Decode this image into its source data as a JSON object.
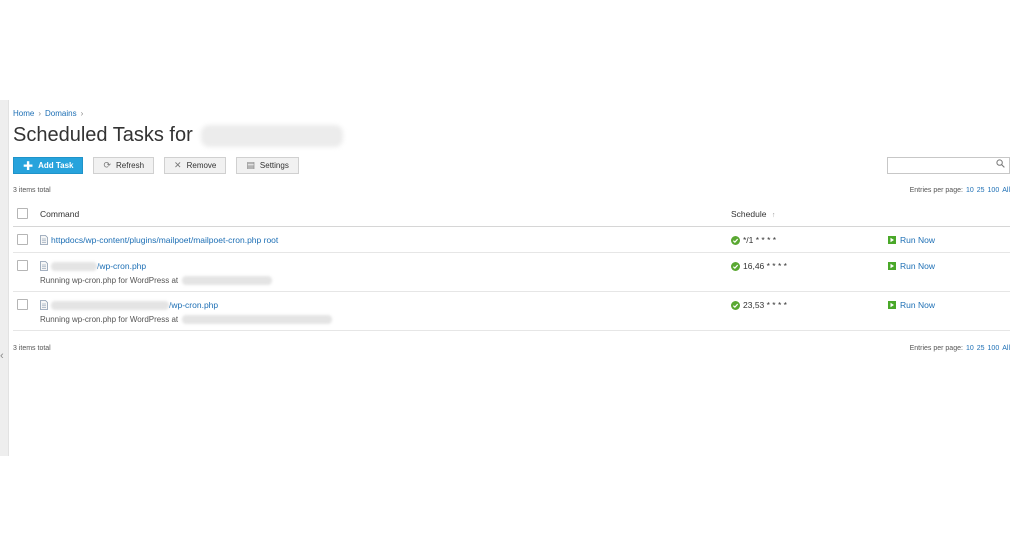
{
  "breadcrumb": {
    "home": "Home",
    "domains": "Domains",
    "separator": "›"
  },
  "page": {
    "title": "Scheduled Tasks for"
  },
  "toolbar": {
    "add_task": "Add Task",
    "refresh": "Refresh",
    "remove": "Remove",
    "settings": "Settings"
  },
  "search": {
    "placeholder": ""
  },
  "summary": {
    "items_total": "3 items total",
    "entries_per_page_label": "Entries per page:",
    "page_sizes": [
      "10",
      "25",
      "100",
      "All"
    ]
  },
  "table": {
    "columns": {
      "command": "Command",
      "schedule": "Schedule",
      "sort_arrow": "↑"
    },
    "rows": [
      {
        "command": "httpdocs/wp-content/plugins/mailpoet/mailpoet-cron.php root",
        "command_suffix": "",
        "description": "",
        "schedule": "*/1 * * * *",
        "action": "Run Now"
      },
      {
        "command": "",
        "command_suffix": "/wp-cron.php",
        "description": "Running wp-cron.php for WordPress at",
        "schedule": "16,46 * * * *",
        "action": "Run Now"
      },
      {
        "command": "",
        "command_suffix": "/wp-cron.php",
        "description": "Running wp-cron.php for WordPress at",
        "schedule": "23,53 * * * *",
        "action": "Run Now"
      }
    ]
  },
  "icons": {
    "add": "plus-icon",
    "refresh": "refresh-icon",
    "remove": "remove-icon",
    "settings": "settings-icon",
    "search": "search-icon",
    "file": "file-icon",
    "status_ok": "check-circle-icon",
    "run": "play-icon",
    "collapse": "chevron-left-icon"
  },
  "colors": {
    "primary": "#27a3dc",
    "link": "#1d6fb5",
    "ok": "#5aa832",
    "run": "#4aa829"
  }
}
